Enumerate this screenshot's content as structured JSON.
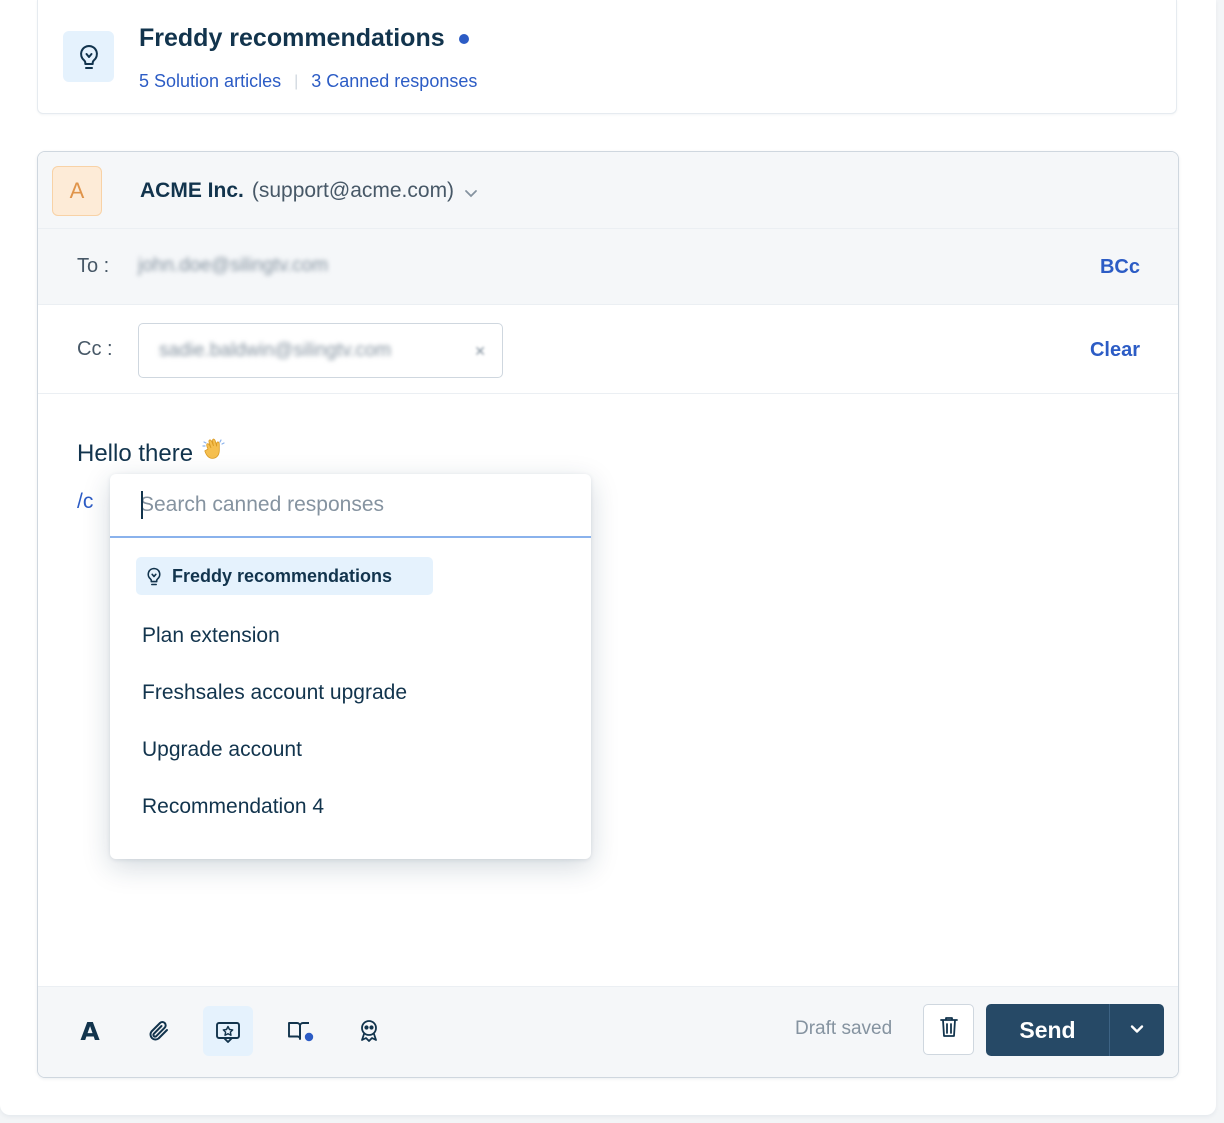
{
  "freddy_card": {
    "title": "Freddy recommendations",
    "solution_articles_link": "5 Solution articles",
    "separator": "|",
    "canned_responses_link": "3 Canned responses",
    "icon": "lightbulb-icon"
  },
  "reply": {
    "from": {
      "avatar_letter": "A",
      "name": "ACME Inc.",
      "email": "(support@acme.com)"
    },
    "to": {
      "label": "To :",
      "value": "john.doe@silingtv.com",
      "bcc_label": "BCc"
    },
    "cc": {
      "label": "Cc :",
      "value": "sadie.baldwin@silingtv.com",
      "clear_label": "Clear"
    },
    "body": {
      "greeting": "Hello there",
      "greeting_emoji": "👋",
      "slash_command": "/c"
    }
  },
  "canned_dropdown": {
    "search_placeholder": "Search canned responses",
    "section_tag": "Freddy recommendations",
    "items": [
      "Plan extension",
      "Freshsales account upgrade",
      "Upgrade account",
      "Recommendation 4"
    ]
  },
  "footer": {
    "tools": [
      "text-format-icon",
      "attachment-icon",
      "canned-response-icon",
      "solution-article-icon",
      "freddy-icon"
    ],
    "draft_status": "Draft saved",
    "send_label": "Send"
  },
  "colors": {
    "accent": "#2c5cc5",
    "primary_button": "#264966",
    "text_primary": "#12344d",
    "highlight_bg": "#e5f2fd"
  }
}
